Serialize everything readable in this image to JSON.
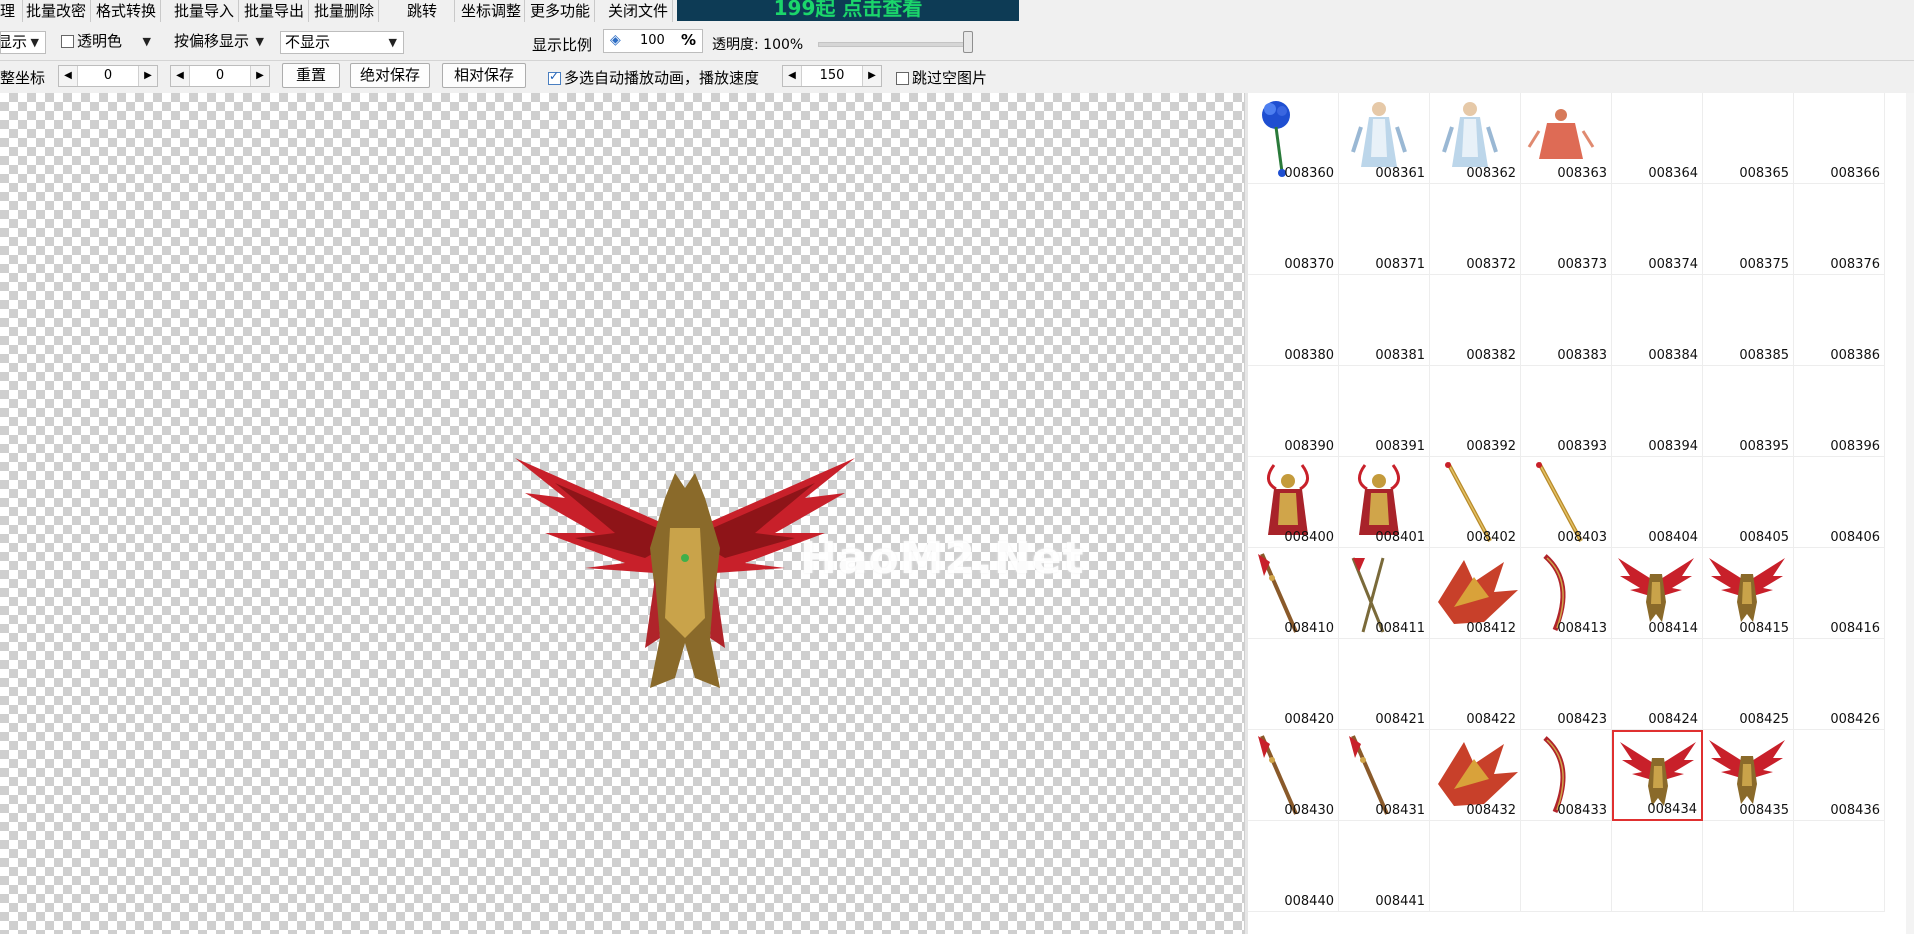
{
  "toolbar1": {
    "buttons": [
      "理",
      "批量改密",
      "格式转换",
      "批量导入",
      "批量导出",
      "批量删除",
      "跳转",
      "坐标调整",
      "更多功能",
      "关闭文件"
    ],
    "banner": "199起 点击查看",
    "banner_color": "#1bd66b"
  },
  "toolbar2": {
    "display_combo": "显示",
    "transparent_label": "透明色",
    "offset_combo": "按偏移显示",
    "hide_combo": "不显示",
    "zoom_label": "显示比例",
    "zoom_value": "100",
    "zoom_unit": "%",
    "opacity_label": "透明度: 100%",
    "opacity_value_percent": 100
  },
  "toolbar3": {
    "coord_label": "整坐标",
    "x_value": "0",
    "y_value": "0",
    "reset_button": "重置",
    "abs_save_button": "绝对保存",
    "rel_save_button": "相对保存",
    "autoplay_label": "多选自动播放动画，播放速度",
    "autoplay_checked": true,
    "speed_value": "150",
    "skip_empty_label": "跳过空图片",
    "skip_empty_checked": false
  },
  "canvas": {
    "watermark": "HaoM2.Net",
    "preview_icon": "winged-warrior-sprite"
  },
  "grid": {
    "selected": "008434",
    "rows": [
      [
        "008360",
        "008361",
        "008362",
        "008363",
        "008364",
        "008365",
        "008366"
      ],
      [
        "008370",
        "008371",
        "008372",
        "008373",
        "008374",
        "008375",
        "008376"
      ],
      [
        "008380",
        "008381",
        "008382",
        "008383",
        "008384",
        "008385",
        "008386"
      ],
      [
        "008390",
        "008391",
        "008392",
        "008393",
        "008394",
        "008395",
        "008396"
      ],
      [
        "008400",
        "008401",
        "008402",
        "008403",
        "008404",
        "008405",
        "008406"
      ],
      [
        "008410",
        "008411",
        "008412",
        "008413",
        "008414",
        "008415",
        "008416"
      ],
      [
        "008420",
        "008421",
        "008422",
        "008423",
        "008424",
        "008425",
        "008426"
      ],
      [
        "008430",
        "008431",
        "008432",
        "008433",
        "008434",
        "008435",
        "008436"
      ],
      [
        "008440",
        "008441",
        "",
        "",
        "",
        "",
        ""
      ]
    ],
    "thumbnails": {
      "008360": "blue-flower-bouquet",
      "008361": "white-robed-figure",
      "008362": "white-robed-figure",
      "008363": "red-costume-figure",
      "008400": "horned-warrior",
      "008401": "horned-warrior",
      "008402": "golden-staff",
      "008403": "golden-staff",
      "008410": "ornate-spear",
      "008411": "double-blade",
      "008412": "phoenix-wing",
      "008413": "curved-blade",
      "008414": "winged-warrior",
      "008415": "winged-warrior",
      "008430": "ornate-spear",
      "008431": "ornate-spear",
      "008432": "phoenix-wing",
      "008433": "curved-blade",
      "008434": "winged-warrior",
      "008435": "winged-warrior"
    }
  }
}
